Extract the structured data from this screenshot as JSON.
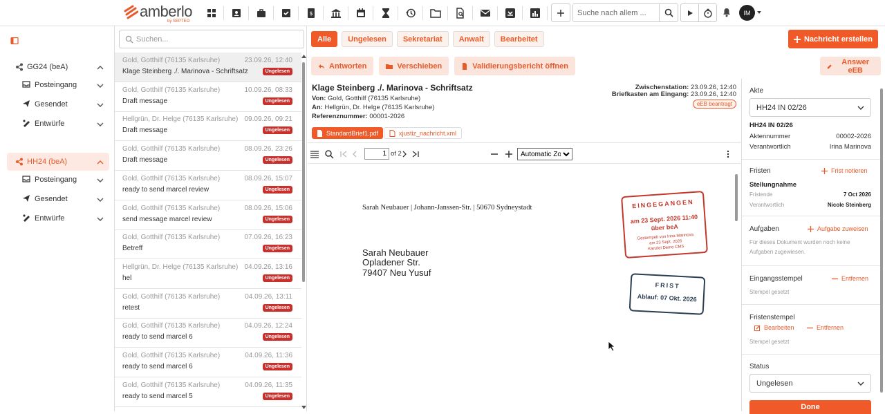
{
  "brand": {
    "name": "amberlo",
    "sub": "by SEPTEO"
  },
  "topbar": {
    "search_placeholder": "Suche nach allem ...",
    "avatar_initials": "IM",
    "nav_icons": [
      "dashboard-icon",
      "contacts-icon",
      "briefcase-icon",
      "tasks-icon",
      "billing-icon",
      "court-icon",
      "calendar-icon",
      "hourglass-icon",
      "history-icon",
      "folder-icon",
      "document-search-icon",
      "mail-icon",
      "bea-inbox-icon",
      "reports-icon"
    ]
  },
  "sidebar": {
    "groups": [
      {
        "label": "GG24 (beA)",
        "active": false,
        "items": [
          "Posteingang",
          "Gesendet",
          "Entwürfe"
        ]
      },
      {
        "label": "HH24 (beA)",
        "active": true,
        "items": [
          "Posteingang",
          "Gesendet",
          "Entwürfe"
        ]
      }
    ]
  },
  "list": {
    "search_placeholder": "Suchen...",
    "messages": [
      {
        "from": "Gold, Gotthilf (76135 Karlsruhe)",
        "date": "23.09.26, 12:40",
        "subject": "Klage Steinberg ./. Marinova - Schriftsatz",
        "badge": "Ungelesen",
        "selected": true
      },
      {
        "from": "Gold, Gotthilf (76135 Karlsruhe)",
        "date": "10.09.26, 08:33",
        "subject": "Draft message",
        "badge": "Ungelesen"
      },
      {
        "from": "Hellgrün, Dr. Helge (76135 Karlsruhe)",
        "date": "09.09.26, 09:21",
        "subject": "Draft message",
        "badge": "Ungelesen"
      },
      {
        "from": "Gold, Gotthilf (76135 Karlsruhe)",
        "date": "08.09.26, 23:26",
        "subject": "Draft message",
        "badge": "Ungelesen"
      },
      {
        "from": "Gold, Gotthilf (76135 Karlsruhe)",
        "date": "08.09.26, 15:07",
        "subject": "ready to send marcel review",
        "badge": "Ungelesen"
      },
      {
        "from": "Gold, Gotthilf (76135 Karlsruhe)",
        "date": "08.09.26, 15:06",
        "subject": "send message marcel review",
        "badge": "Ungelesen"
      },
      {
        "from": "Gold, Gotthilf (76135 Karlsruhe)",
        "date": "07.09.26, 16:23",
        "subject": "Betreff",
        "badge": "Ungelesen"
      },
      {
        "from": "Hellgrün, Dr. Helge (76135 Karlsruhe)",
        "date": "04.09.26, 13:16",
        "subject": "hel",
        "badge": "Ungelesen"
      },
      {
        "from": "Gold, Gotthilf (76135 Karlsruhe)",
        "date": "04.09.26, 13:11",
        "subject": "retest",
        "badge": "Ungelesen"
      },
      {
        "from": "Gold, Gotthilf (76135 Karlsruhe)",
        "date": "04.09.26, 12:24",
        "subject": "ready to send marcel 6",
        "badge": "Ungelesen"
      },
      {
        "from": "Gold, Gotthilf (76135 Karlsruhe)",
        "date": "04.09.26, 11:36",
        "subject": "ready to send marcel 6",
        "badge": "Ungelesen"
      },
      {
        "from": "Gold, Gotthilf (76135 Karlsruhe)",
        "date": "04.09.26, 11:35",
        "subject": "ready to send marcel 5",
        "badge": "Ungelesen"
      }
    ]
  },
  "filters": {
    "items": [
      "Alle",
      "Ungelesen",
      "Sekretariat",
      "Anwalt",
      "Bearbeitet"
    ],
    "active": "Alle",
    "new_message": "Nachricht erstellen"
  },
  "actions": {
    "reply": "Antworten",
    "move": "Verschieben",
    "validation": "Validierungsbericht öffnen",
    "answer_eeb": "Answer eEB"
  },
  "message": {
    "subject": "Klage Steinberg ./. Marinova - Schriftsatz",
    "from_label": "Von:",
    "from": "Gold, Gotthilf (76135 Karlsruhe)",
    "to_label": "An:",
    "to": "Hellgrün, Dr. Helge (76135 Karlsruhe)",
    "ref_label": "Referenznummer:",
    "ref": "00001-2026",
    "zwischen_label": "Zwischenstation:",
    "zwischen": "23.09.26, 12:40",
    "briefkasten_label": "Briefkasten am Eingang:",
    "briefkasten": "23.09.26, 12:40",
    "eeb": "eEB beantragt",
    "attachments": [
      "StandardBrief1.pdf",
      "xjustiz_nachricht.xml"
    ]
  },
  "pdf": {
    "page": "1",
    "of": "of 2",
    "zoom": "Automatic Zoom"
  },
  "document": {
    "sender_line": "Sarah Neubauer | Johann-Janssen-Str. | 50670 Sydneystadt",
    "address": [
      "Sarah Neubauer",
      "Opladener Str.",
      "79407 Neu Yusuf"
    ],
    "stamp_received": {
      "title": "EINGEGANGEN",
      "line1": "am 23 Sept. 2026 11:40",
      "line2": "über beA",
      "small1": "Gestempelt von Irina Marinova",
      "small2": "am 23 Sept. 2026",
      "small3": "Kanzlei Demo CMS"
    },
    "stamp_deadline": {
      "title": "FRIST",
      "line": "Ablauf: 07 Okt. 2026"
    }
  },
  "details": {
    "akte_label": "Akte",
    "akte_value": "HH24 IN 02/26",
    "akte_title": "HH24 IN 02/26",
    "aktennummer_label": "Aktennummer",
    "aktennummer": "00002-2026",
    "verantwortlich_label": "Verantwortlich",
    "verantwortlich": "Irina Marinova",
    "fristen_label": "Fristen",
    "frist_add": "Frist notieren",
    "frist_title": "Stellungnahme",
    "fristende_label": "Fristende",
    "fristende": "7 Oct 2026",
    "frist_verantwortlich_label": "Verantwortlich",
    "frist_verantwortlich": "Nicole Steinberg",
    "aufgaben_label": "Aufgaben",
    "aufgabe_add": "Aufgabe zuweisen",
    "aufgaben_note": "Für dieses Dokument wurden noch keine Aufgaben zugewiesen.",
    "eingangsstempel_label": "Eingangsstempel",
    "eingangsstempel_remove": "Entfernen",
    "eingangsstempel_note": "Stempel gesetzt",
    "fristenstempel_label": "Fristenstempel",
    "fristenstempel_edit": "Bearbeiten",
    "fristenstempel_remove": "Entfernen",
    "fristenstempel_note": "Stempel gesetzt",
    "status_label": "Status",
    "status_value": "Ungelesen",
    "done": "Done"
  },
  "colors": {
    "accent": "#f05a28",
    "badge": "#c9302c"
  }
}
